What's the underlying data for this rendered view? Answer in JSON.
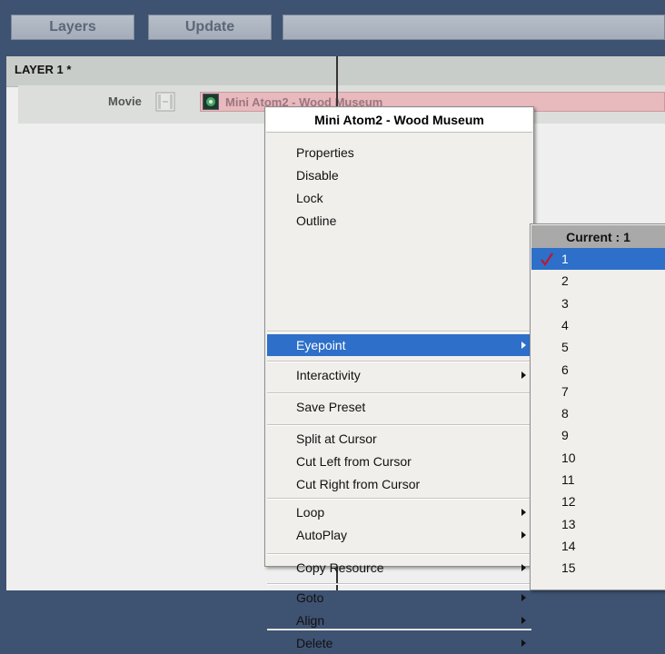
{
  "tabs": {
    "layers": "Layers",
    "update": "Update"
  },
  "layer": {
    "title": "LAYER 1 *",
    "track_type": "Movie",
    "clip_name": "Mini Atom2 - Wood Museum"
  },
  "context_menu": {
    "title": "Mini Atom2 - Wood Museum",
    "groups": [
      [
        "Properties",
        "Disable",
        "Lock",
        "Outline"
      ],
      [
        "Eyepoint"
      ],
      [
        "Interactivity"
      ],
      [
        "Save Preset"
      ],
      [
        "Split at Cursor",
        "Cut Left from Cursor",
        "Cut Right from Cursor"
      ],
      [
        "Loop",
        "AutoPlay"
      ],
      [
        "Copy Resource"
      ],
      [
        "Goto",
        "Align"
      ],
      [
        "Delete"
      ]
    ],
    "submenu_items": [
      "Eyepoint",
      "Interactivity",
      "Loop",
      "AutoPlay",
      "Copy Resource",
      "Goto",
      "Align",
      "Delete"
    ],
    "selected_item": "Eyepoint"
  },
  "eyepoint_submenu": {
    "title": "Current : 1",
    "items": [
      "1",
      "2",
      "3",
      "4",
      "5",
      "6",
      "7",
      "8",
      "9",
      "10",
      "11",
      "12",
      "13",
      "14",
      "15"
    ],
    "selected": "1"
  },
  "icons": {
    "check": "check-icon",
    "film": "film-icon",
    "submenu_arrow": "chevron-right-icon"
  },
  "colors": {
    "selection": "#2d6fc9",
    "clip": "#e8b9bd",
    "check": "#c0182a"
  }
}
